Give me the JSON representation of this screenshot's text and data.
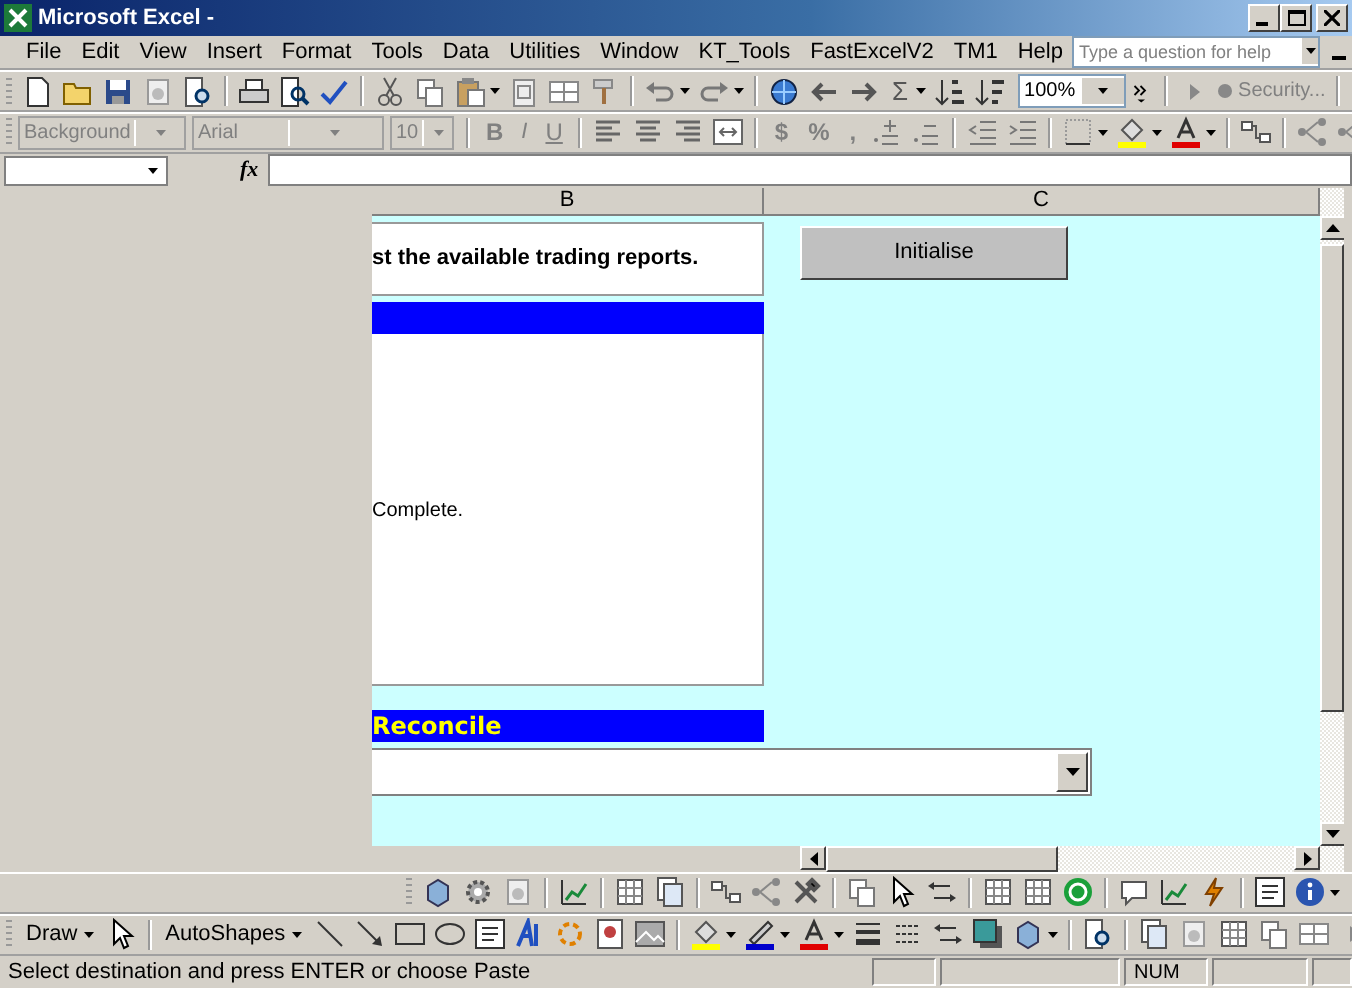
{
  "window": {
    "title": "Microsoft Excel -"
  },
  "menu": [
    "File",
    "Edit",
    "View",
    "Insert",
    "Format",
    "Tools",
    "Data",
    "Utilities",
    "Window",
    "KT_Tools",
    "FastExcelV2",
    "TM1",
    "Help"
  ],
  "help_box": {
    "placeholder": "Type a question for help"
  },
  "standard_toolbar": {
    "autosum": "Σ",
    "zoom": "100%",
    "security": "Security..."
  },
  "formatting_toolbar": {
    "combos": [
      {
        "kind": "style",
        "value": "Background",
        "disabled": true
      },
      {
        "kind": "font",
        "value": "Arial",
        "disabled": true
      },
      {
        "kind": "size",
        "value": "10",
        "disabled": true
      }
    ],
    "buttons": [
      {
        "kind": "bold",
        "label": "B",
        "disabled": true
      },
      {
        "kind": "italic",
        "label": "I",
        "disabled": true
      },
      {
        "kind": "underline",
        "label": "U",
        "disabled": true
      }
    ],
    "number_buttons": [
      {
        "label": "$",
        "disabled": true
      },
      {
        "label": "%",
        "disabled": true
      },
      {
        "label": ",",
        "disabled": true
      }
    ]
  },
  "formula_bar": {
    "function_label": "fx"
  },
  "sheet": {
    "columns": [
      "B",
      "C"
    ],
    "instruction": "st the available trading reports.",
    "status_text": "Complete.",
    "initialise_button": "Initialise",
    "reconcile_heading": "Reconcile"
  },
  "drawing_toolbar": {
    "draw": "Draw",
    "autoshapes": "AutoShapes"
  },
  "status_bar": {
    "message": "Select destination and press ENTER or choose Paste",
    "indicators": [
      "NUM"
    ]
  }
}
